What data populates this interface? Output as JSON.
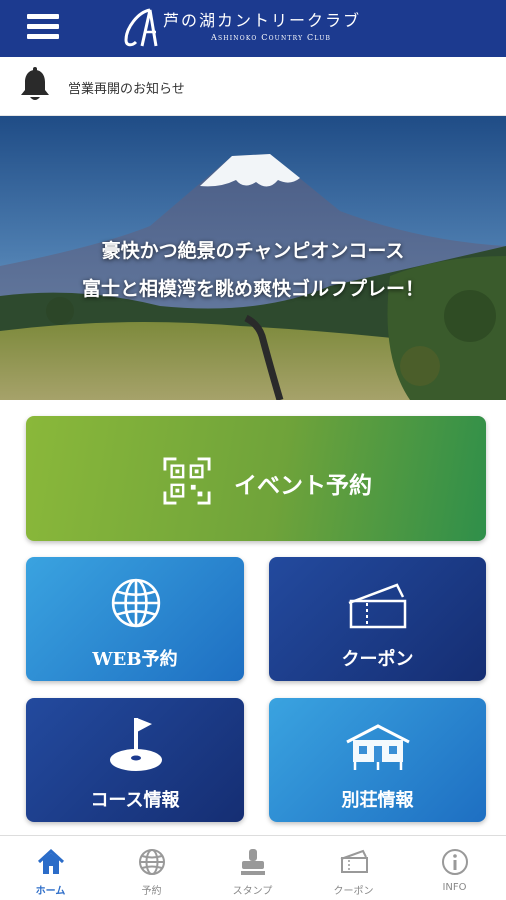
{
  "header": {
    "title": "芦の湖カントリークラブ",
    "subtitle": "Ashinoko Country Club"
  },
  "notice": {
    "text": "営業再開のお知らせ"
  },
  "hero": {
    "line1": "豪快かつ絶景のチャンピオンコース",
    "line2": "富士と相模湾を眺め爽快ゴルフプレー！"
  },
  "tiles": {
    "event": "イベント予約",
    "web": "WEB予約",
    "coupon": "クーポン",
    "course": "コース情報",
    "villa": "別荘情報"
  },
  "tabs": [
    {
      "label": "ホーム",
      "icon": "home-icon",
      "active": true
    },
    {
      "label": "予約",
      "icon": "globe-icon",
      "active": false
    },
    {
      "label": "スタンプ",
      "icon": "stamp-icon",
      "active": false
    },
    {
      "label": "クーポン",
      "icon": "ticket-icon",
      "active": false
    },
    {
      "label": "INFO",
      "icon": "info-icon",
      "active": false
    }
  ],
  "colors": {
    "header": "#1c3a8f",
    "active_tab": "#2b6cc8",
    "event_tile": "#8ab83a",
    "tile_blue": "#2a7fd0",
    "tile_navy": "#1c3a8f"
  }
}
